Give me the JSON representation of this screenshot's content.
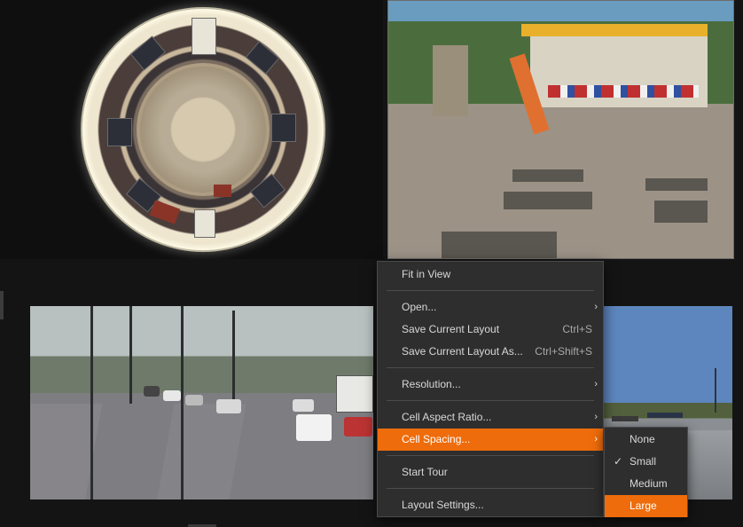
{
  "cameras": [
    {
      "name": "fisheye-office",
      "kind": "fisheye"
    },
    {
      "name": "beach-boardwalk",
      "kind": "standard"
    },
    {
      "name": "city-street",
      "kind": "standard"
    },
    {
      "name": "parking-lot",
      "kind": "standard"
    }
  ],
  "menu": {
    "items": [
      {
        "label": "Fit in View",
        "shortcut": "",
        "submenu": false
      },
      {
        "label": "Open...",
        "shortcut": "",
        "submenu": true
      },
      {
        "label": "Save Current Layout",
        "shortcut": "Ctrl+S",
        "submenu": false
      },
      {
        "label": "Save Current Layout As...",
        "shortcut": "Ctrl+Shift+S",
        "submenu": false
      },
      {
        "label": "Resolution...",
        "shortcut": "",
        "submenu": true
      },
      {
        "label": "Cell Aspect Ratio...",
        "shortcut": "",
        "submenu": true
      },
      {
        "label": "Cell Spacing...",
        "shortcut": "",
        "submenu": true,
        "highlighted": true
      },
      {
        "label": "Start Tour",
        "shortcut": "",
        "submenu": false
      },
      {
        "label": "Layout Settings...",
        "shortcut": "",
        "submenu": false
      }
    ],
    "arrow_glyph": "›"
  },
  "submenu": {
    "items": [
      {
        "label": "None",
        "checked": false
      },
      {
        "label": "Small",
        "checked": true
      },
      {
        "label": "Medium",
        "checked": false
      },
      {
        "label": "Large",
        "checked": false,
        "highlighted": true
      }
    ],
    "check_glyph": "✓"
  },
  "colors": {
    "highlight": "#ee6c0b",
    "menu_bg": "#2e2e2f",
    "background": "#141414"
  }
}
